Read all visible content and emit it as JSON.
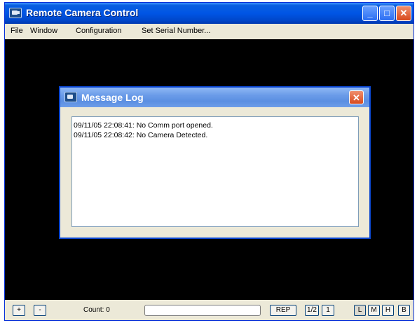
{
  "window": {
    "title": "Remote Camera Control"
  },
  "titlebar_buttons": {
    "minimize": "_",
    "maximize": "□",
    "close": "✕"
  },
  "menu": [
    "File",
    "Window",
    "Configuration",
    "Set Serial Number..."
  ],
  "dialog": {
    "title": "Message Log",
    "close": "✕",
    "log_lines": [
      "09/11/05 22:08:41: No Comm port opened.",
      "09/11/05 22:08:42: No Camera Detected."
    ]
  },
  "statusbar": {
    "plus": "+",
    "minus": "-",
    "count_label": "Count: 0",
    "progress": 0,
    "rep": "REP",
    "half": "1/2",
    "one": "1",
    "l": "L",
    "m": "M",
    "h": "H",
    "b": "B"
  },
  "icons": [
    "app-camera-icon",
    "dialog-camera-icon"
  ]
}
